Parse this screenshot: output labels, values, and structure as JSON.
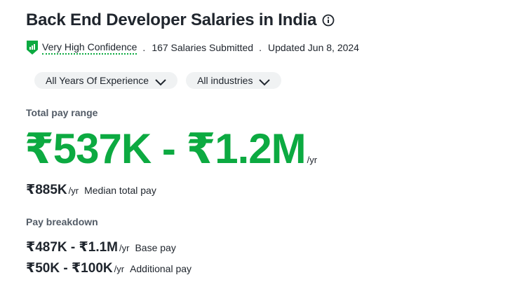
{
  "header": {
    "title": "Back End Developer Salaries in India"
  },
  "meta": {
    "confidence": "Very High Confidence",
    "separator": ".",
    "salaries_submitted": "167 Salaries Submitted",
    "updated": "Updated Jun 8, 2024"
  },
  "filters": {
    "experience": "All Years Of Experience",
    "industries": "All industries"
  },
  "total_pay": {
    "label": "Total pay range",
    "range": "₹537K - ₹1.2M",
    "unit": "/yr",
    "median_value": "₹885K",
    "median_unit": "/yr",
    "median_label": "Median total pay"
  },
  "breakdown": {
    "label": "Pay breakdown",
    "base_value": "₹487K - ₹1.1M",
    "base_unit": "/yr",
    "base_label": "Base pay",
    "additional_value": "₹50K - ₹100K",
    "additional_unit": "/yr",
    "additional_label": "Additional pay"
  },
  "colors": {
    "accent_green": "#0caa41",
    "text_dark": "#20262e",
    "text_muted": "#525b66",
    "pill_bg": "#f0f2f3"
  },
  "icons": {
    "info": "info-icon",
    "confidence": "shield-icon",
    "dropdown": "chevron-down-icon"
  }
}
